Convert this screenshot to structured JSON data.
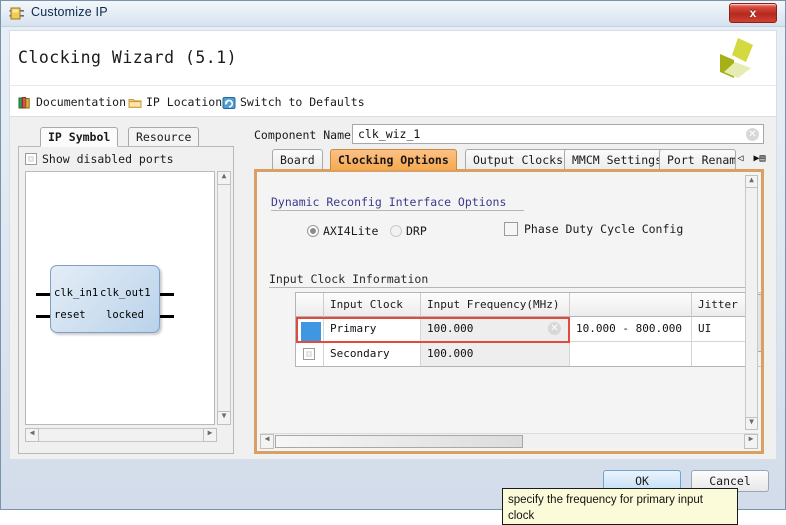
{
  "window": {
    "title": "Customize IP",
    "title_icon": "ip-customize-icon",
    "close_label": "x"
  },
  "header": {
    "title": "Clocking Wizard (5.1)",
    "logo": "xilinx-logo"
  },
  "toolbar": {
    "items": [
      {
        "label": "Documentation",
        "icon": "books-icon"
      },
      {
        "label": "IP Location",
        "icon": "folder-icon"
      },
      {
        "label": "Switch to Defaults",
        "icon": "refresh-icon"
      }
    ]
  },
  "left_panel": {
    "tabs": [
      {
        "label": "IP Symbol",
        "selected": true
      },
      {
        "label": "Resource",
        "selected": false
      }
    ],
    "show_disabled_ports": {
      "label": "Show disabled ports",
      "checked": false
    },
    "symbol": {
      "inputs": [
        "clk_in1",
        "reset"
      ],
      "outputs": [
        "clk_out1",
        "locked"
      ]
    }
  },
  "right_panel": {
    "component_name": {
      "label": "Component Name",
      "value": "clk_wiz_1",
      "clear_icon": "clear-icon"
    },
    "tabs": [
      {
        "label": "Board",
        "active": false
      },
      {
        "label": "Clocking Options",
        "active": true
      },
      {
        "label": "Output Clocks",
        "active": false
      },
      {
        "label": "MMCM Settings",
        "active": false
      },
      {
        "label": "Port Renam:",
        "active": false
      }
    ],
    "tab_nav": {
      "prev_icon": "chevron-left-icon",
      "next_icon": "chevron-right-icon",
      "list_icon": "tab-list-icon"
    },
    "clocking_options": {
      "dynamic_reconfig": {
        "title": "Dynamic Reconfig Interface Options",
        "radios": [
          {
            "label": "AXI4Lite",
            "selected": true
          },
          {
            "label": "DRP",
            "selected": false
          }
        ],
        "checkbox": {
          "label": "Phase Duty Cycle Config",
          "checked": false
        }
      },
      "input_clock_information": {
        "title": "Input Clock Information",
        "columns": [
          "",
          "Input Clock",
          "Input Frequency(MHz)",
          "",
          "Jitter O"
        ],
        "rows": [
          {
            "selected": true,
            "input_clock": "Primary",
            "input_frequency": "100.000",
            "range": "10.000 - 800.000",
            "jitter_units": "UI",
            "clear_icon": "clear-icon"
          },
          {
            "selected": false,
            "input_clock": "Secondary",
            "input_frequency": "100.000",
            "range": "",
            "jitter_units": ""
          }
        ]
      }
    }
  },
  "tooltip": {
    "text": "specify the frequency for primary input clock"
  },
  "footer": {
    "ok_label": "OK",
    "cancel_label": "Cancel"
  },
  "colors": {
    "active_tab": "#f7a94f",
    "pane_border": "#d9a063",
    "selection_red": "#e04a3f",
    "selection_blue": "#3e97e0",
    "tooltip_bg": "#fbfbd9"
  }
}
